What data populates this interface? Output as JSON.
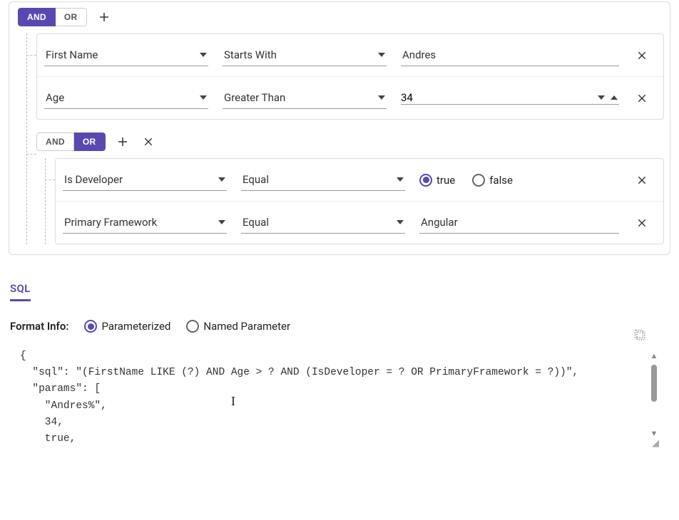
{
  "root": {
    "and_label": "AND",
    "or_label": "OR",
    "active": "AND"
  },
  "rules": [
    {
      "field": "First Name",
      "operator": "Starts With",
      "value": "Andres",
      "value_type": "text"
    },
    {
      "field": "Age",
      "operator": "Greater Than",
      "value": "34",
      "value_type": "number"
    }
  ],
  "subgroup": {
    "and_label": "AND",
    "or_label": "OR",
    "active": "OR",
    "rules": [
      {
        "field": "Is Developer",
        "operator": "Equal",
        "value_type": "bool",
        "true_label": "true",
        "false_label": "false",
        "selected": "true"
      },
      {
        "field": "Primary Framework",
        "operator": "Equal",
        "value_type": "text",
        "value": "Angular"
      }
    ]
  },
  "output": {
    "tab": "SQL",
    "format_label": "Format Info:",
    "opt_param": "Parameterized",
    "opt_named": "Named Parameter",
    "format_selected": "Parameterized",
    "code_lines": [
      "{",
      "  \"sql\": \"(FirstName LIKE (?) AND Age > ? AND (IsDeveloper = ? OR PrimaryFramework = ?))\",",
      "  \"params\": [",
      "    \"Andres%\",",
      "    34,",
      "    true,"
    ]
  },
  "colors": {
    "accent": "#5a48b0"
  }
}
